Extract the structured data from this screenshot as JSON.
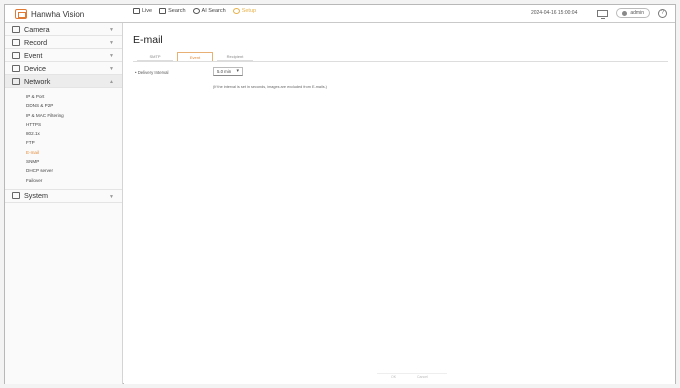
{
  "app": {
    "title": "Hanwha Vision"
  },
  "topnav": {
    "items": [
      {
        "label": "Live",
        "icon": "live-icon",
        "active": false
      },
      {
        "label": "Search",
        "icon": "search-icon",
        "active": false
      },
      {
        "label": "AI Search",
        "icon": "ai-search-icon",
        "active": false
      },
      {
        "label": "Setup",
        "icon": "setup-icon",
        "active": true
      }
    ],
    "datetime": "2024-04-16 15:00:04",
    "user": "admin"
  },
  "sidebar": {
    "menus": [
      {
        "label": "Camera",
        "icon": "camera-icon"
      },
      {
        "label": "Record",
        "icon": "record-icon"
      },
      {
        "label": "Event",
        "icon": "event-icon"
      },
      {
        "label": "Device",
        "icon": "device-icon"
      },
      {
        "label": "Network",
        "icon": "network-icon"
      }
    ],
    "network_items": [
      "IP & Port",
      "DDNS & P2P",
      "IP & MAC Filtering",
      "HTTPS",
      "802.1x",
      "FTP",
      "E-mail",
      "SNMP",
      "DHCP server",
      "Failover"
    ],
    "system": {
      "label": "System",
      "icon": "system-icon"
    }
  },
  "main": {
    "title": "E-mail",
    "tabs": [
      {
        "label": "SMTP",
        "active": false
      },
      {
        "label": "Event",
        "active": true
      },
      {
        "label": "Recipient",
        "active": false
      }
    ],
    "interval_label": "• Delivery Interval",
    "interval_value": "5.0 min",
    "note": "(If the interval is set in seconds, images are excluded from E-mails.)"
  },
  "footer": {
    "ok": "OK",
    "cancel": "Cancel"
  },
  "colors": {
    "accent": "#e48c3c",
    "setup_active": "#e8b24a"
  }
}
